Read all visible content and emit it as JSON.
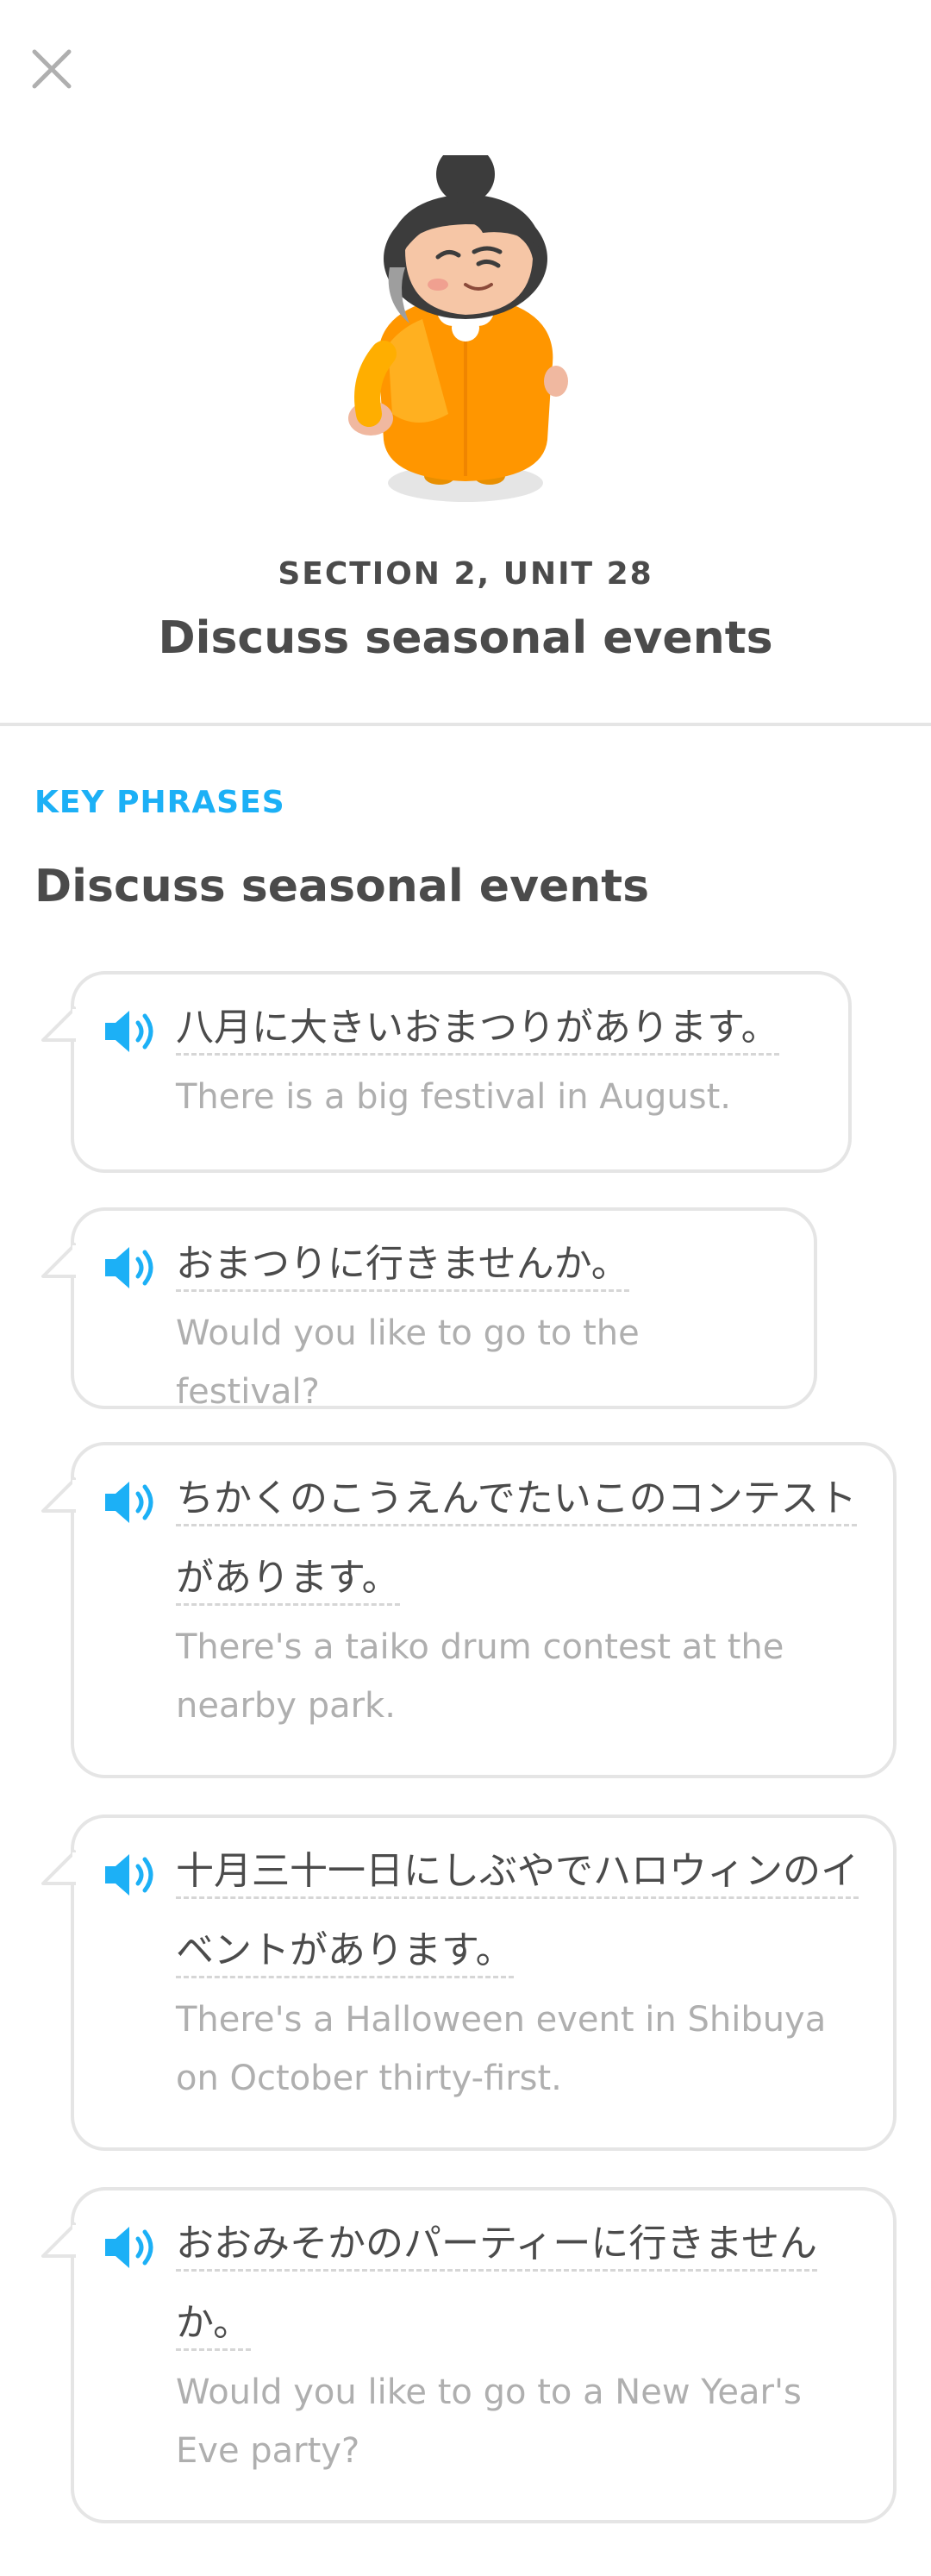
{
  "header": {
    "close_icon": "close-icon"
  },
  "unit": {
    "section_label": "SECTION 2, UNIT 28",
    "title": "Discuss seasonal events",
    "character_icon": "character-illustration"
  },
  "key_phrases": {
    "label": "KEY PHRASES",
    "title": "Discuss seasonal events",
    "speaker_icon": "speaker-icon",
    "accent_color": "#1cb0f6",
    "items": [
      {
        "japanese": "八月に大きいおまつりがあります。",
        "english": "There is a big festival in August."
      },
      {
        "japanese": "おまつりに行きませんか。",
        "english": "Would you like to go to the festival?"
      },
      {
        "japanese": "ちかくのこうえんでたいこのコンテストがあります。",
        "english": "There's a taiko drum contest at the nearby park."
      },
      {
        "japanese": "十月三十一日にしぶやでハロウィンのイベントがあります。",
        "english": "There's a Halloween event in Shibuya on October thirty-first."
      },
      {
        "japanese": "おおみそかのパーティーに行きませんか。",
        "english": "Would you like to go to a New Year's Eve party?"
      }
    ]
  }
}
